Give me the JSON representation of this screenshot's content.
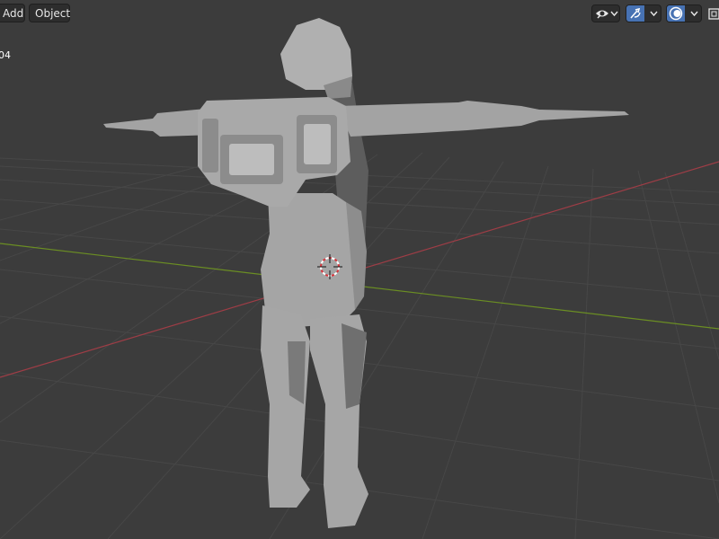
{
  "header": {
    "menu": [
      {
        "label": "Add"
      },
      {
        "label": "Object"
      }
    ],
    "tools": {
      "visibility_icon": "eye-icon",
      "gizmo_icon": "gizmo-arrow-icon",
      "overlay_icon": "overlays-icon",
      "xray_icon": "xray-icon",
      "dropdown_icon": "chevron-down-icon",
      "active_color": "#4772b3"
    }
  },
  "viewport": {
    "object_label": "04",
    "background_color": "#3c3c3c",
    "grid_color": "#474747",
    "x_axis_color": "#9e3d46",
    "y_axis_color": "#6b8e23",
    "model_color": "#a8a8a8",
    "cursor_icon": "3d-cursor-icon"
  }
}
